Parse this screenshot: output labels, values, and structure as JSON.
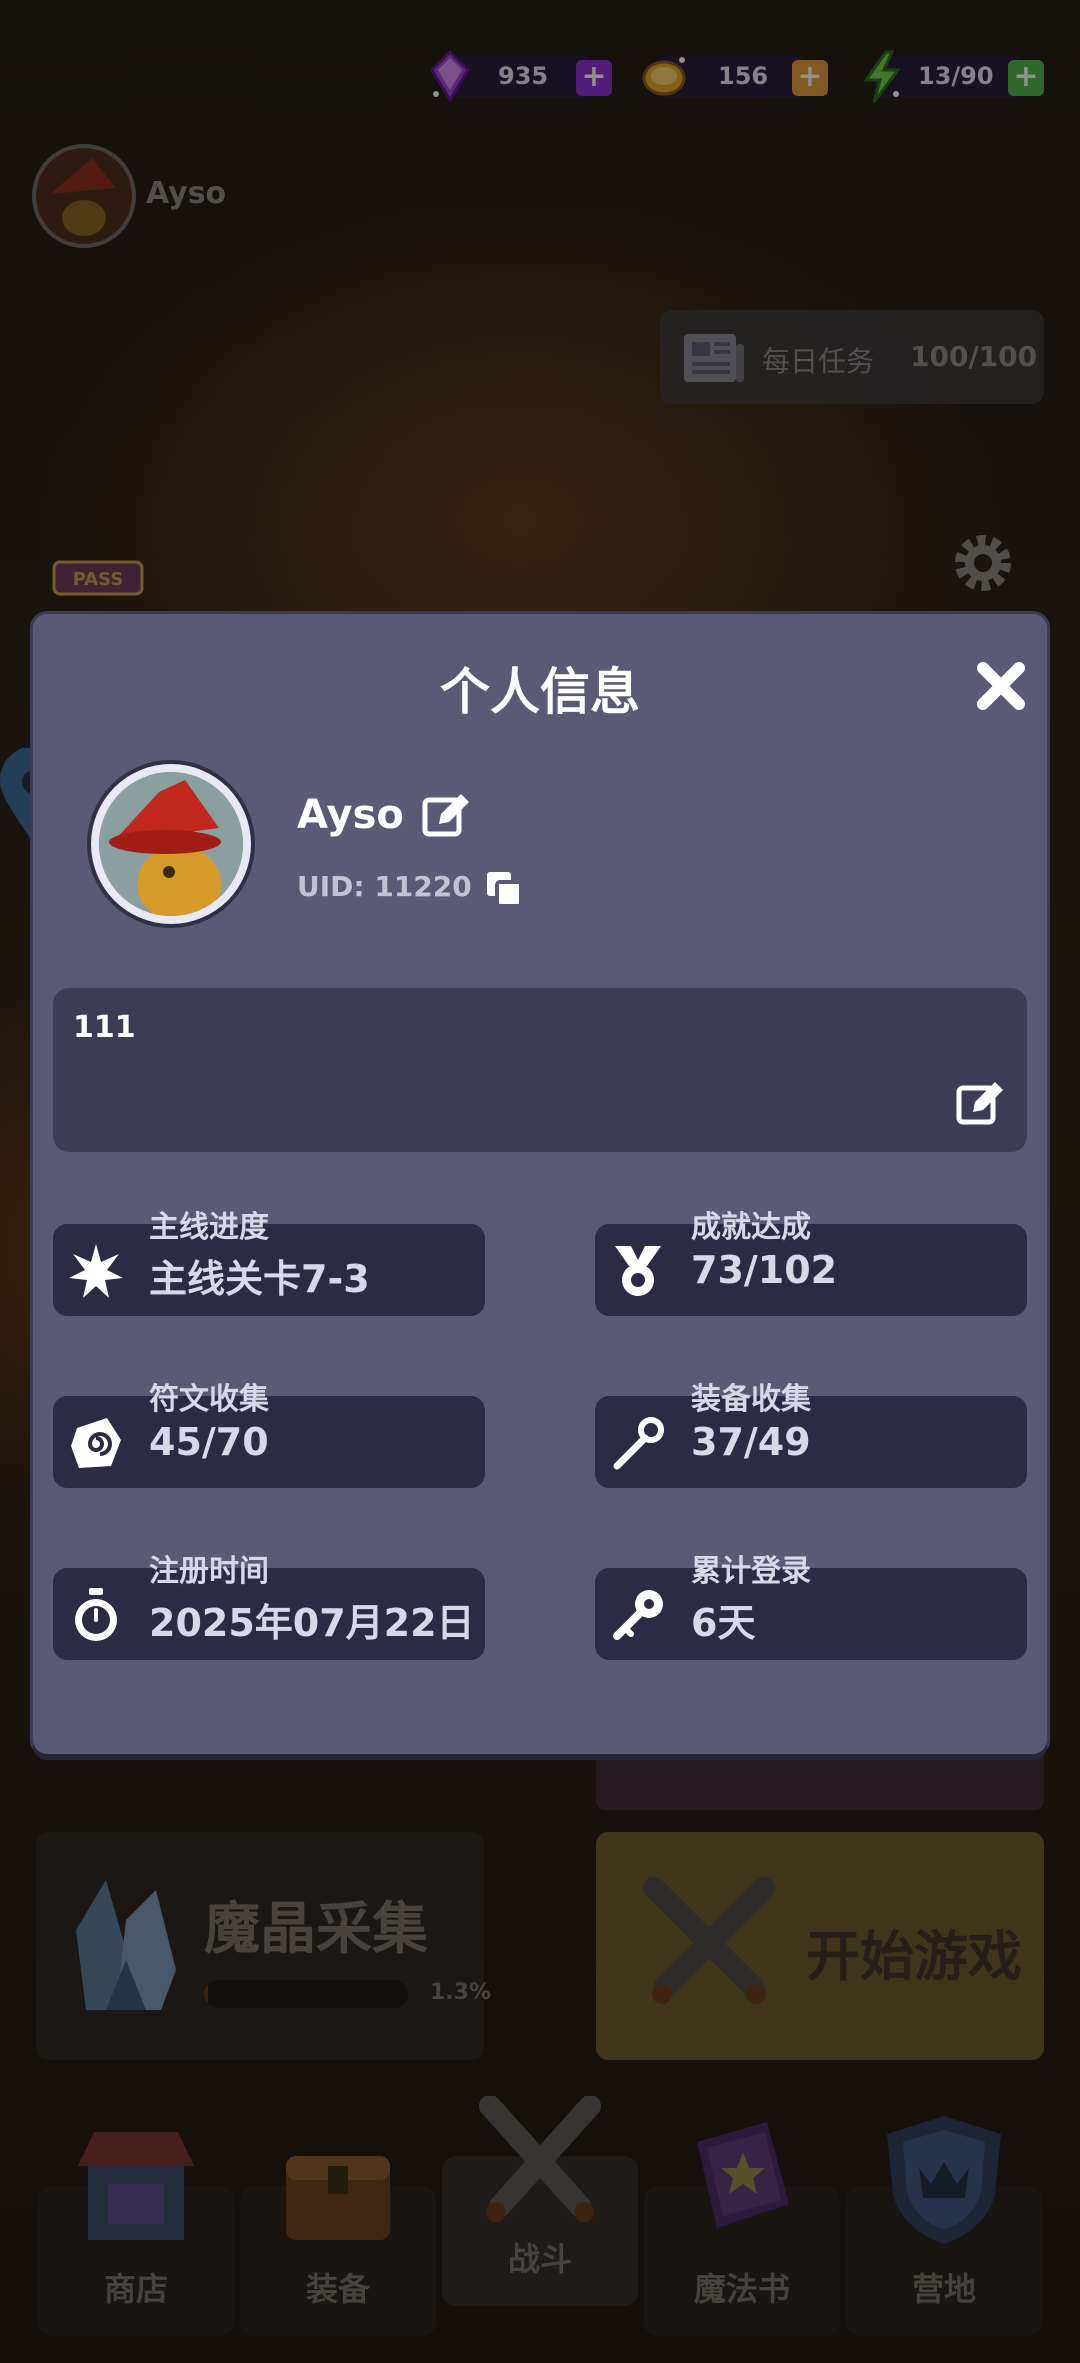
{
  "currencies": [
    {
      "name": "gem",
      "value": "935",
      "icon": "purple-gem-icon",
      "color": "#8c2fd6"
    },
    {
      "name": "gold",
      "value": "156",
      "icon": "gold-coin-icon",
      "color": "#e39a3b"
    },
    {
      "name": "energy",
      "value": "13/90",
      "icon": "lightning-icon",
      "color": "#4fb548"
    }
  ],
  "header": {
    "player_name": "Ayso"
  },
  "daily_task": {
    "label": "每日任务",
    "value": "100/100"
  },
  "crystal": {
    "title": "魔晶采集",
    "progress_text": "1.3%",
    "progress": 0.013
  },
  "start_game": {
    "label": "开始游戏"
  },
  "nav": [
    {
      "label": "商店",
      "icon": "shop-icon"
    },
    {
      "label": "装备",
      "icon": "chest-icon"
    },
    {
      "label": "战斗",
      "icon": "crossed-swords-icon",
      "active": true
    },
    {
      "label": "魔法书",
      "icon": "spellbook-icon"
    },
    {
      "label": "营地",
      "icon": "shield-crown-icon"
    }
  ],
  "modal": {
    "title": "个人信息",
    "name": "Ayso",
    "uid": "UID: 11220",
    "signature": "111",
    "stats": [
      {
        "label": "主线进度",
        "value": "主线关卡7-3",
        "icon": "starburst-icon"
      },
      {
        "label": "成就达成",
        "value": "73/102",
        "icon": "medal-icon"
      },
      {
        "label": "符文收集",
        "value": "45/70",
        "icon": "rune-stone-icon"
      },
      {
        "label": "装备收集",
        "value": "37/49",
        "icon": "staff-icon"
      },
      {
        "label": "注册时间",
        "value": "2025年07月22日",
        "icon": "stopwatch-icon"
      },
      {
        "label": "累计登录",
        "value": "6天",
        "icon": "key-icon"
      }
    ]
  }
}
